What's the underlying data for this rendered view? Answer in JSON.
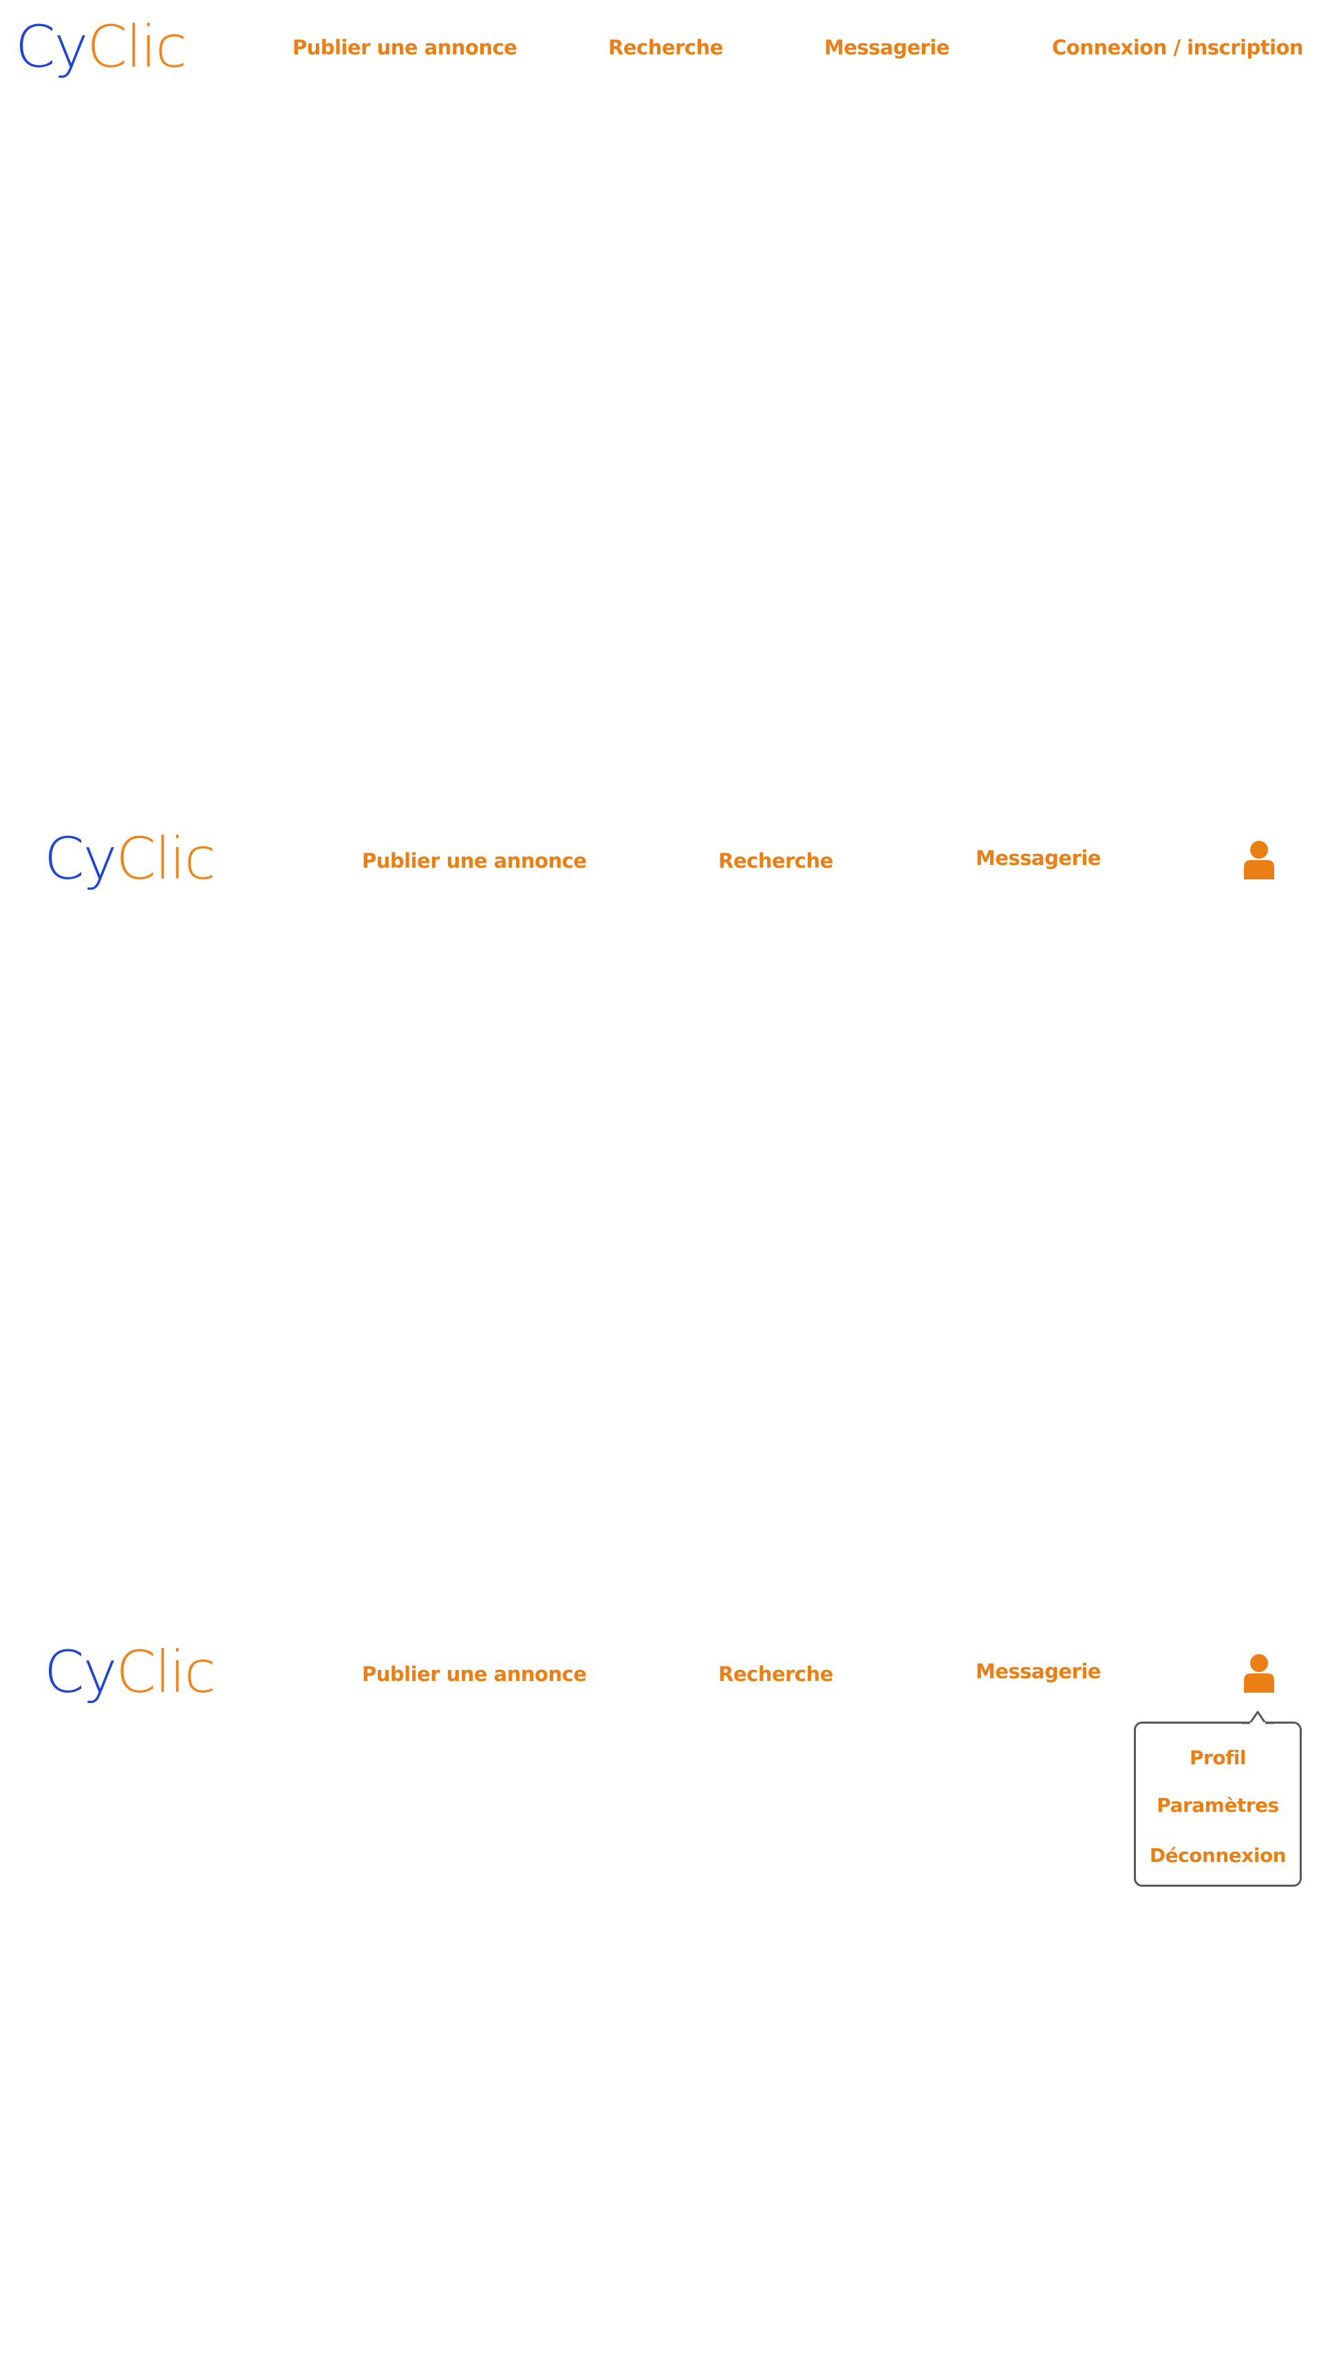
{
  "brand": {
    "logo_part_1": "Cy",
    "logo_part_2": "Clic",
    "color_blue": "#1f44d8",
    "color_orange": "#f08418"
  },
  "state_logged_out": {
    "nav": {
      "publish": "Publier une annonce",
      "search": "Recherche",
      "messages": "Messagerie",
      "login": "Connexion / inscription"
    }
  },
  "state_logged_in": {
    "nav": {
      "publish": "Publier une annonce",
      "search": "Recherche",
      "messages": "Messagerie"
    },
    "user_icon": "user-icon"
  },
  "state_menu_open": {
    "nav": {
      "publish": "Publier une annonce",
      "search": "Recherche",
      "messages": "Messagerie"
    },
    "user_icon": "user-icon",
    "dropdown": {
      "profile": "Profil",
      "settings": "Paramètres",
      "logout": "Déconnexion"
    }
  },
  "colors": {
    "link": "#ec7f14",
    "dropdown_border": "#58595b"
  }
}
